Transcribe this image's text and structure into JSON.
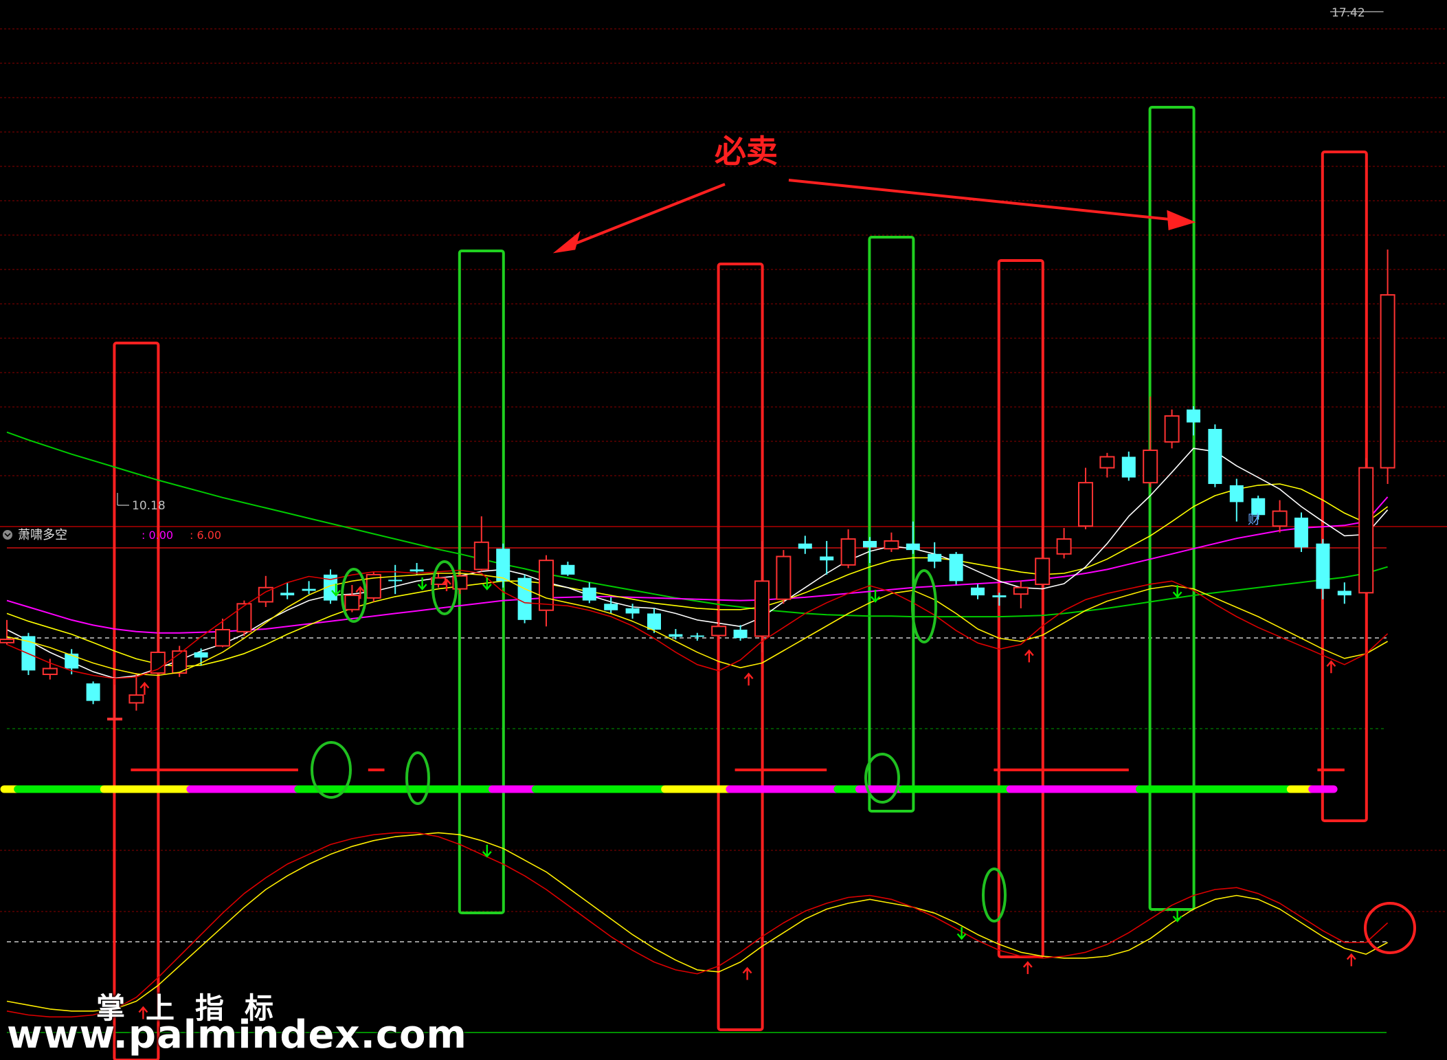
{
  "chart_data": {
    "type": "candlestick-with-indicators",
    "price_high_label": "17.42",
    "price_low_label": "10.18",
    "annotation": "必卖",
    "fin_badge": "财",
    "indicator": {
      "name": "萧啸多空",
      "value1": ": 0.00",
      "value2": ": 6.00"
    },
    "candles": [
      [
        11.35,
        11.4,
        11.7,
        11.32
      ],
      [
        11.45,
        10.92,
        11.5,
        10.85
      ],
      [
        10.86,
        10.95,
        11.1,
        10.78
      ],
      [
        11.18,
        10.95,
        11.25,
        10.86
      ],
      [
        10.72,
        10.45,
        10.75,
        10.4
      ],
      [
        10.18,
        10.18,
        10.7,
        10.18
      ],
      [
        10.42,
        10.54,
        10.88,
        10.3
      ],
      [
        10.88,
        11.2,
        11.85,
        10.8
      ],
      [
        10.88,
        11.22,
        11.3,
        10.82
      ],
      [
        11.2,
        11.12,
        11.26,
        11.0
      ],
      [
        11.3,
        11.55,
        11.72,
        11.28
      ],
      [
        11.52,
        11.95,
        12.0,
        11.45
      ],
      [
        11.98,
        12.2,
        12.38,
        11.9
      ],
      [
        12.12,
        12.08,
        12.28,
        12.02
      ],
      [
        12.18,
        12.15,
        12.3,
        12.1
      ],
      [
        12.4,
        12.0,
        12.48,
        11.95
      ],
      [
        11.86,
        12.08,
        12.24,
        11.82
      ],
      [
        12.04,
        12.4,
        12.45,
        11.98
      ],
      [
        12.32,
        12.3,
        12.55,
        12.1
      ],
      [
        12.48,
        12.45,
        12.58,
        12.4
      ],
      [
        12.25,
        12.35,
        12.42,
        12.2
      ],
      [
        12.18,
        12.38,
        12.45,
        12.1
      ],
      [
        12.48,
        12.9,
        13.3,
        12.45
      ],
      [
        12.8,
        12.3,
        12.88,
        12.2
      ],
      [
        12.35,
        11.7,
        12.4,
        11.65
      ],
      [
        11.85,
        12.62,
        12.7,
        11.6
      ],
      [
        12.55,
        12.4,
        12.6,
        12.38
      ],
      [
        12.2,
        12.0,
        12.28,
        11.96
      ],
      [
        11.95,
        11.85,
        12.05,
        11.8
      ],
      [
        11.88,
        11.8,
        11.95,
        11.72
      ],
      [
        11.8,
        11.55,
        11.88,
        11.5
      ],
      [
        11.48,
        11.44,
        11.56,
        11.4
      ],
      [
        11.46,
        11.44,
        11.5,
        11.38
      ],
      [
        11.46,
        11.6,
        11.88,
        11.4
      ],
      [
        11.55,
        11.42,
        11.62,
        11.38
      ],
      [
        11.45,
        12.3,
        12.92,
        11.2
      ],
      [
        12.02,
        12.68,
        12.78,
        11.95
      ],
      [
        12.88,
        12.8,
        13.0,
        12.72
      ],
      [
        12.68,
        12.62,
        12.92,
        12.4
      ],
      [
        12.55,
        12.95,
        13.1,
        12.5
      ],
      [
        12.92,
        12.82,
        12.98,
        12.58
      ],
      [
        12.8,
        12.92,
        13.05,
        12.75
      ],
      [
        12.88,
        12.78,
        13.22,
        12.72
      ],
      [
        12.72,
        12.6,
        12.9,
        12.5
      ],
      [
        12.72,
        12.3,
        12.75,
        12.25
      ],
      [
        12.2,
        12.08,
        12.25,
        12.02
      ],
      [
        12.08,
        12.05,
        12.12,
        11.92
      ],
      [
        12.1,
        12.2,
        12.3,
        11.88
      ],
      [
        12.25,
        12.65,
        13.1,
        12.2
      ],
      [
        12.72,
        12.95,
        13.12,
        12.65
      ],
      [
        13.15,
        13.82,
        14.05,
        13.1
      ],
      [
        14.05,
        14.22,
        14.28,
        13.9
      ],
      [
        14.22,
        13.9,
        14.3,
        13.85
      ],
      [
        13.82,
        14.32,
        15.15,
        13.75
      ],
      [
        14.45,
        14.85,
        14.95,
        14.35
      ],
      [
        14.95,
        14.75,
        15.0,
        14.55
      ],
      [
        14.65,
        13.8,
        14.72,
        13.75
      ],
      [
        13.78,
        13.52,
        13.88,
        13.22
      ],
      [
        13.58,
        13.32,
        13.62,
        13.25
      ],
      [
        13.15,
        13.38,
        13.55,
        13.05
      ],
      [
        13.28,
        12.82,
        13.36,
        12.75
      ],
      [
        12.88,
        12.18,
        12.95,
        12.02
      ],
      [
        12.15,
        12.08,
        12.28,
        11.95
      ],
      [
        12.12,
        14.05,
        14.2,
        12.1
      ],
      [
        14.05,
        16.72,
        17.42,
        13.8
      ]
    ],
    "ma5": [
      11.55,
      11.38,
      11.2,
      11.05,
      10.9,
      10.8,
      10.84,
      10.95,
      11.08,
      11.22,
      11.33,
      11.48,
      11.68,
      11.85,
      12.0,
      12.08,
      12.1,
      12.14,
      12.22,
      12.3,
      12.35,
      12.38,
      12.45,
      12.48,
      12.4,
      12.28,
      12.2,
      12.08,
      11.98,
      11.9,
      11.88,
      11.8,
      11.7,
      11.65,
      11.6,
      11.74,
      11.98,
      12.2,
      12.42,
      12.62,
      12.76,
      12.84,
      12.8,
      12.72,
      12.6,
      12.45,
      12.3,
      12.2,
      12.18,
      12.26,
      12.52,
      12.88,
      13.3,
      13.62,
      13.98,
      14.35,
      14.3,
      14.08,
      13.9,
      13.72,
      13.45,
      13.22,
      13.0,
      13.02,
      13.4
    ],
    "ma10": [
      11.8,
      11.68,
      11.58,
      11.48,
      11.35,
      11.22,
      11.1,
      11.02,
      10.98,
      11.0,
      11.08,
      11.18,
      11.32,
      11.48,
      11.62,
      11.76,
      11.88,
      11.98,
      12.06,
      12.12,
      12.18,
      12.22,
      12.26,
      12.3,
      12.3,
      12.26,
      12.2,
      12.14,
      12.08,
      12.02,
      11.96,
      11.92,
      11.88,
      11.86,
      11.86,
      11.9,
      12.0,
      12.12,
      12.26,
      12.4,
      12.52,
      12.62,
      12.66,
      12.66,
      12.62,
      12.56,
      12.5,
      12.44,
      12.4,
      12.42,
      12.5,
      12.64,
      12.82,
      13.0,
      13.22,
      13.45,
      13.62,
      13.72,
      13.78,
      13.8,
      13.72,
      13.55,
      13.35,
      13.2,
      13.45
    ],
    "ma20": [
      12.0,
      11.9,
      11.8,
      11.7,
      11.62,
      11.56,
      11.52,
      11.5,
      11.5,
      11.51,
      11.52,
      11.54,
      11.56,
      11.6,
      11.64,
      11.68,
      11.72,
      11.76,
      11.8,
      11.84,
      11.88,
      11.92,
      11.96,
      12.0,
      12.02,
      12.04,
      12.05,
      12.06,
      12.06,
      12.05,
      12.04,
      12.03,
      12.02,
      12.01,
      12.0,
      12.01,
      12.03,
      12.05,
      12.08,
      12.11,
      12.14,
      12.17,
      12.2,
      12.22,
      12.24,
      12.26,
      12.28,
      12.3,
      12.33,
      12.37,
      12.42,
      12.48,
      12.56,
      12.64,
      12.72,
      12.8,
      12.88,
      12.96,
      13.02,
      13.08,
      13.12,
      13.14,
      13.16,
      13.22,
      13.6
    ],
    "ma60": [
      14.6,
      14.48,
      14.37,
      14.26,
      14.16,
      14.06,
      13.96,
      13.86,
      13.77,
      13.68,
      13.59,
      13.51,
      13.43,
      13.35,
      13.27,
      13.19,
      13.11,
      13.03,
      12.95,
      12.87,
      12.79,
      12.72,
      12.64,
      12.56,
      12.49,
      12.41,
      12.35,
      12.28,
      12.22,
      12.16,
      12.1,
      12.04,
      11.99,
      11.94,
      11.9,
      11.86,
      11.83,
      11.8,
      11.78,
      11.77,
      11.76,
      11.76,
      11.75,
      11.75,
      11.75,
      11.75,
      11.75,
      11.76,
      11.77,
      11.8,
      11.84,
      11.88,
      11.93,
      11.98,
      12.03,
      12.08,
      12.12,
      12.16,
      12.2,
      12.24,
      12.28,
      12.32,
      12.36,
      12.42,
      12.52
    ],
    "ind1_yellow": [
      0.55,
      0.52,
      0.48,
      0.43,
      0.38,
      0.34,
      0.31,
      0.3,
      0.32,
      0.38,
      0.45,
      0.54,
      0.64,
      0.74,
      0.82,
      0.88,
      0.91,
      0.93,
      0.94,
      0.95,
      0.96,
      0.96,
      0.95,
      0.93,
      0.86,
      0.8,
      0.77,
      0.74,
      0.7,
      0.65,
      0.59,
      0.52,
      0.45,
      0.39,
      0.35,
      0.38,
      0.46,
      0.54,
      0.62,
      0.7,
      0.77,
      0.83,
      0.85,
      0.79,
      0.7,
      0.6,
      0.54,
      0.52,
      0.56,
      0.64,
      0.72,
      0.78,
      0.82,
      0.86,
      0.88,
      0.86,
      0.8,
      0.74,
      0.68,
      0.61,
      0.54,
      0.47,
      0.41,
      0.44,
      0.52
    ],
    "ind1_red": [
      0.5,
      0.44,
      0.38,
      0.33,
      0.3,
      0.28,
      0.29,
      0.34,
      0.44,
      0.55,
      0.65,
      0.75,
      0.84,
      0.9,
      0.94,
      0.92,
      0.95,
      0.97,
      0.97,
      0.96,
      0.97,
      0.98,
      0.96,
      0.84,
      0.77,
      0.76,
      0.75,
      0.72,
      0.68,
      0.62,
      0.54,
      0.45,
      0.37,
      0.33,
      0.4,
      0.52,
      0.61,
      0.7,
      0.77,
      0.83,
      0.88,
      0.84,
      0.77,
      0.69,
      0.59,
      0.51,
      0.47,
      0.5,
      0.62,
      0.72,
      0.79,
      0.83,
      0.86,
      0.89,
      0.91,
      0.85,
      0.76,
      0.68,
      0.61,
      0.55,
      0.49,
      0.43,
      0.37,
      0.44,
      0.57
    ],
    "ind2_yellow": [
      0.1,
      0.08,
      0.06,
      0.05,
      0.05,
      0.06,
      0.1,
      0.18,
      0.28,
      0.38,
      0.48,
      0.58,
      0.67,
      0.74,
      0.8,
      0.85,
      0.89,
      0.92,
      0.94,
      0.95,
      0.96,
      0.95,
      0.92,
      0.88,
      0.82,
      0.76,
      0.68,
      0.6,
      0.52,
      0.44,
      0.37,
      0.31,
      0.26,
      0.25,
      0.3,
      0.38,
      0.45,
      0.52,
      0.57,
      0.6,
      0.62,
      0.6,
      0.58,
      0.55,
      0.5,
      0.44,
      0.39,
      0.35,
      0.33,
      0.32,
      0.32,
      0.33,
      0.36,
      0.42,
      0.5,
      0.57,
      0.62,
      0.64,
      0.62,
      0.57,
      0.5,
      0.43,
      0.37,
      0.34,
      0.4
    ],
    "ind2_red": [
      0.05,
      0.03,
      0.02,
      0.02,
      0.03,
      0.06,
      0.12,
      0.22,
      0.33,
      0.44,
      0.55,
      0.65,
      0.73,
      0.8,
      0.85,
      0.9,
      0.93,
      0.95,
      0.96,
      0.96,
      0.94,
      0.9,
      0.85,
      0.8,
      0.74,
      0.67,
      0.59,
      0.51,
      0.43,
      0.36,
      0.3,
      0.26,
      0.24,
      0.28,
      0.35,
      0.43,
      0.5,
      0.56,
      0.6,
      0.63,
      0.64,
      0.62,
      0.58,
      0.53,
      0.47,
      0.41,
      0.36,
      0.33,
      0.32,
      0.33,
      0.35,
      0.39,
      0.45,
      0.52,
      0.59,
      0.64,
      0.67,
      0.68,
      0.65,
      0.6,
      0.53,
      0.46,
      0.4,
      0.4,
      0.5
    ],
    "color_bar": [
      {
        "from": 0,
        "to": 1,
        "color": "#ffff00"
      },
      {
        "from": 1,
        "to": 5,
        "color": "#00ee00"
      },
      {
        "from": 5,
        "to": 9,
        "color": "#ffff00"
      },
      {
        "from": 9,
        "to": 14,
        "color": "#ff00ff"
      },
      {
        "from": 14,
        "to": 23,
        "color": "#00ee00"
      },
      {
        "from": 23,
        "to": 25,
        "color": "#ff00ff"
      },
      {
        "from": 25,
        "to": 31,
        "color": "#00ee00"
      },
      {
        "from": 31,
        "to": 34,
        "color": "#ffff00"
      },
      {
        "from": 34,
        "to": 39,
        "color": "#ff00ff"
      },
      {
        "from": 39,
        "to": 40,
        "color": "#00ee00"
      },
      {
        "from": 40,
        "to": 42,
        "color": "#ff00ff"
      },
      {
        "from": 42,
        "to": 47,
        "color": "#00ee00"
      },
      {
        "from": 47,
        "to": 53,
        "color": "#ff00ff"
      },
      {
        "from": 53,
        "to": 60,
        "color": "#00ee00"
      },
      {
        "from": 60,
        "to": 61,
        "color": "#ffff00"
      },
      {
        "from": 61,
        "to": 62,
        "color": "#ff00ff"
      }
    ],
    "red_segments": [
      [
        6,
        13.5
      ],
      [
        17,
        17.5
      ],
      [
        34,
        38
      ],
      [
        46,
        52
      ],
      [
        61,
        62
      ]
    ],
    "buy_signal_candles": [
      6,
      34,
      47,
      62
    ],
    "sell_signal_candles": [
      22,
      41,
      54
    ],
    "ind1_up_arrows": [
      6,
      16,
      20,
      34,
      47,
      61
    ],
    "ind1_down_arrows": [
      15,
      19,
      22,
      40,
      54
    ],
    "ind2_up_arrows": [
      6,
      34,
      47,
      62
    ],
    "ind2_down_arrows": [
      22,
      44,
      54
    ],
    "colors": {
      "up": "#ff3232",
      "down": "#54ffff",
      "ma5": "#ffffff",
      "ma10": "#ffff00",
      "ma20": "#ff00ff",
      "ma60": "#00cc00",
      "buy_box": "#ff2020",
      "sell_box": "#20d020",
      "grid": "#8b0000",
      "arrow_red": "#ff2020",
      "arrow_green": "#00ee00"
    }
  },
  "watermark": {
    "cn": "掌上指标",
    "url": "www.palmindex.com"
  }
}
